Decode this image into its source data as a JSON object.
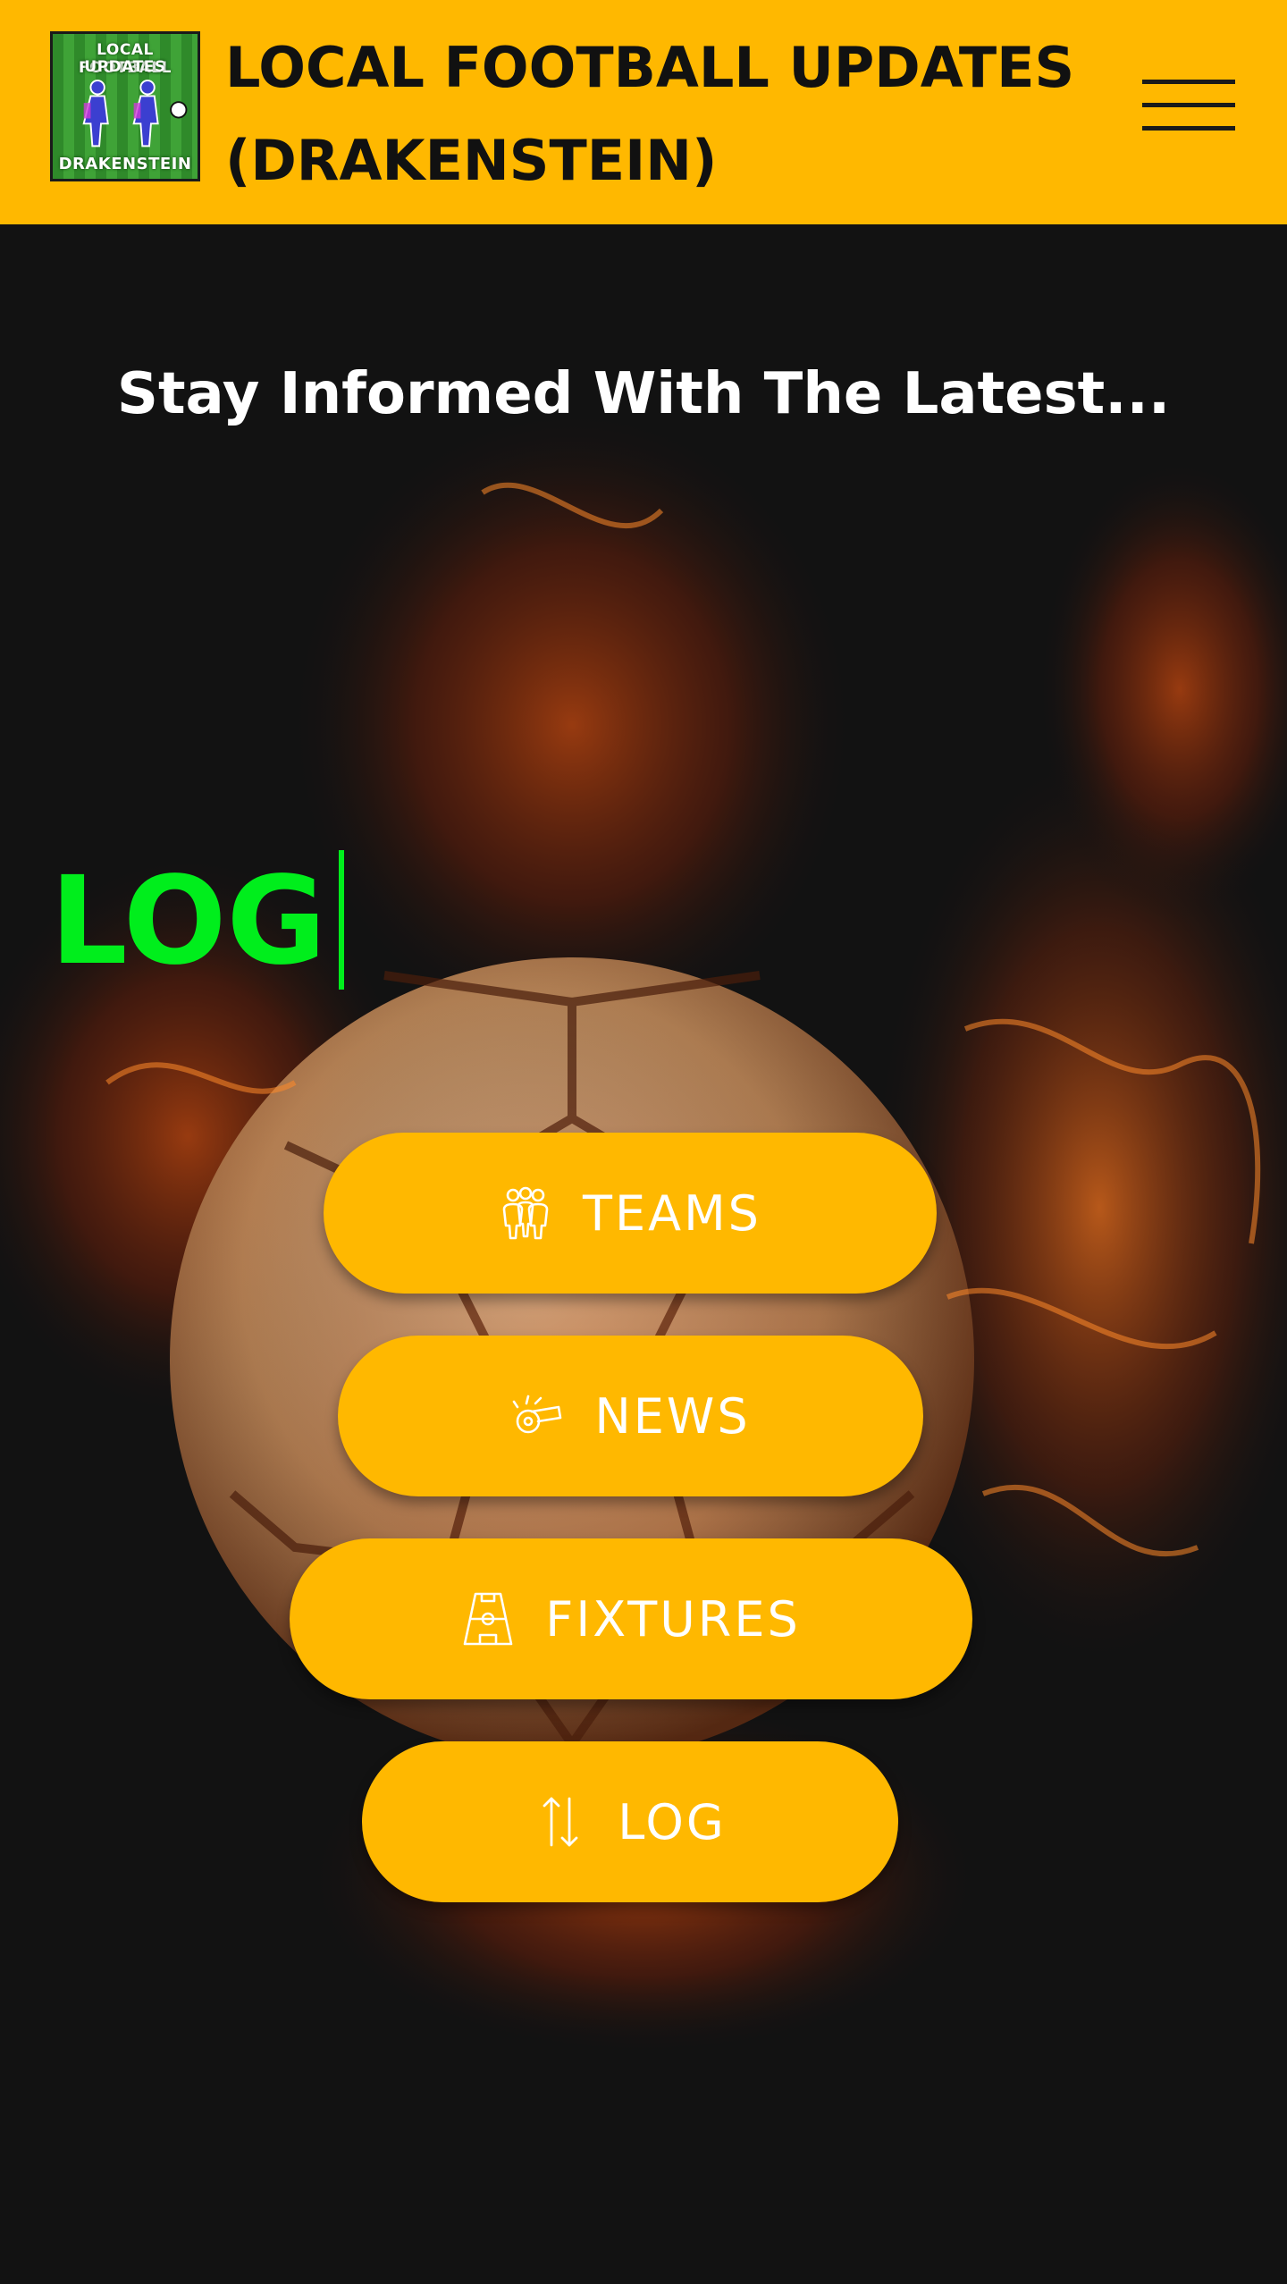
{
  "header": {
    "logo": {
      "line1": "LOCAL FOOTBALL",
      "line2": "UPDATES",
      "line3": "DRAKENSTEIN"
    },
    "title": "LOCAL FOOTBALL UPDATES (DRAKENSTEIN)",
    "menu_icon": "hamburger-menu-icon"
  },
  "hero": {
    "tagline": "Stay Informed With The Latest...",
    "typed_word": "LOG"
  },
  "nav_buttons": [
    {
      "label": "TEAMS",
      "icon": "people-group-icon"
    },
    {
      "label": "NEWS",
      "icon": "whistle-icon"
    },
    {
      "label": "FIXTURES",
      "icon": "football-pitch-icon"
    },
    {
      "label": "LOG",
      "icon": "sort-arrows-icon"
    }
  ],
  "colors": {
    "brand_yellow": "#FFB800",
    "background": "#121212",
    "typed_green": "#00EE1C",
    "button_text": "#FFFFFF"
  }
}
